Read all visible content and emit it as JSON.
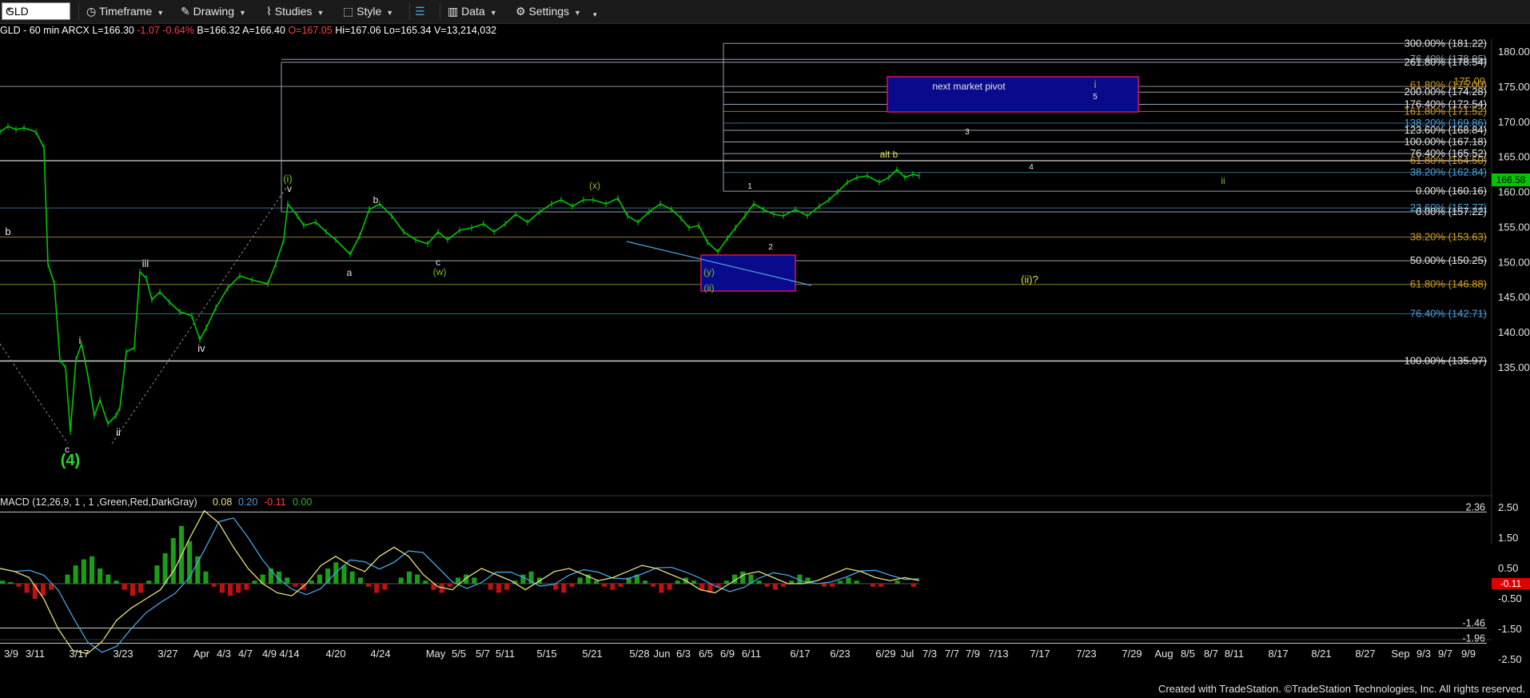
{
  "toolbar": {
    "symbol": "GLD",
    "timeframe": "Timeframe",
    "drawing": "Drawing",
    "studies": "Studies",
    "style": "Style",
    "data": "Data",
    "settings": "Settings"
  },
  "quote": {
    "name": "GLD - 60 min",
    "exchange": "ARCX",
    "last": "L=166.30",
    "change": "-1.07",
    "pct": "-0.64%",
    "bid": "B=166.32",
    "ask_label": "A=166.40",
    "open": "O=167.05",
    "high": "Hi=167.06",
    "low": "Lo=165.34",
    "volume": "V=13,214,032"
  },
  "colors": {
    "price": "#00c800",
    "fib_line": "#8f96a8",
    "box_fill": "#0a0a8c",
    "box_border": "#d4145a",
    "wave_green": "#7fbf2a",
    "wave_yellow": "#e5e04d",
    "macd_line": "#e8e07a",
    "signal_line": "#4aa3df",
    "hist_up": "#1b9d1b",
    "hist_dn": "#c01010"
  },
  "price_axis": [
    "180.00",
    "175.00",
    "170.00",
    "165.00",
    "160.00",
    "155.00",
    "150.00",
    "145.00",
    "140.00",
    "135.00"
  ],
  "price_tag": "166.58",
  "fib_labels": [
    {
      "text": "300.00% (181.22)",
      "color": "#e6e6e6"
    },
    {
      "text": "76.40% (178.95)",
      "color": "#8fa3b3"
    },
    {
      "text": "261.80% (178.54)",
      "color": "#e6e6e6"
    },
    {
      "text": "61.80% (175.00)",
      "color": "#d4a017"
    },
    {
      "text": "175.09",
      "color": "#d4a017"
    },
    {
      "text": "200.00% (174.28)",
      "color": "#e6e6e6"
    },
    {
      "text": "176.40% (172.54)",
      "color": "#e6e6e6"
    },
    {
      "text": "161.80% (171.52)",
      "color": "#d4a017"
    },
    {
      "text": "138.20% (169.86)",
      "color": "#4aa3df"
    },
    {
      "text": "123.60% (168.84)",
      "color": "#e6e6e6"
    },
    {
      "text": "100.00% (167.18)",
      "color": "#e6e6e6"
    },
    {
      "text": "76.40% (165.52)",
      "color": "#e6e6e6"
    },
    {
      "text": "61.80% (164.50)",
      "color": "#d4a017"
    },
    {
      "text": "38.20% (162.84)",
      "color": "#4aa3df"
    },
    {
      "text": "0.00% (160.16)",
      "color": "#e6e6e6"
    },
    {
      "text": "23.60% (157.77)",
      "color": "#4aa3df"
    },
    {
      "text": "0.00% (157.22)",
      "color": "#e6e6e6"
    },
    {
      "text": "38.20% (153.63)",
      "color": "#d4a017"
    },
    {
      "text": "50.00% (150.25)",
      "color": "#e6e6e6"
    },
    {
      "text": "61.80% (146.88)",
      "color": "#d4a017"
    },
    {
      "text": "76.40% (142.71)",
      "color": "#4aa3df"
    },
    {
      "text": "100.00% (135.97)",
      "color": "#e6e6e6"
    }
  ],
  "wave_labels": [
    {
      "text": "b",
      "color": "#e6e6e6"
    },
    {
      "text": "i",
      "color": "#e6e6e6"
    },
    {
      "text": "ii",
      "color": "#e6e6e6"
    },
    {
      "text": "iii",
      "color": "#e6e6e6"
    },
    {
      "text": "iv",
      "color": "#e6e6e6"
    },
    {
      "text": "c",
      "color": "#e6e6e6"
    },
    {
      "text": "(4)",
      "color": "#22dd22"
    },
    {
      "text": "(i)",
      "color": "#7fbf2a"
    },
    {
      "text": "v",
      "color": "#e6e6e6"
    },
    {
      "text": "a",
      "color": "#e6e6e6"
    },
    {
      "text": "b",
      "color": "#e6e6e6"
    },
    {
      "text": "c",
      "color": "#e6e6e6"
    },
    {
      "text": "(w)",
      "color": "#7fbf2a"
    },
    {
      "text": "(x)",
      "color": "#7fbf2a"
    },
    {
      "text": "(y)",
      "color": "#7fbf2a"
    },
    {
      "text": "(ii)",
      "color": "#7fbf2a"
    },
    {
      "text": "1",
      "color": "#e6e6e6"
    },
    {
      "text": "2",
      "color": "#e6e6e6"
    },
    {
      "text": "3",
      "color": "#e6e6e6"
    },
    {
      "text": "4",
      "color": "#e6e6e6"
    },
    {
      "text": "5",
      "color": "#e6e6e6"
    },
    {
      "text": "i",
      "color": "#7fbf2a"
    },
    {
      "text": "ii",
      "color": "#7fbf2a"
    },
    {
      "text": "alt b",
      "color": "#e5e04d"
    },
    {
      "text": "(ii)?",
      "color": "#e5e04d"
    }
  ],
  "pivot_label": "next market pivot",
  "macd": {
    "title": "MACD (12,26,9, 1 , 1 ,Green,Red,DarkGray)",
    "v1": "0.08",
    "v2": "0.20",
    "v3": "-0.11",
    "v4": "0.00",
    "axis": [
      "2.50",
      "1.50",
      "0.50",
      "-0.50",
      "-1.50",
      "-2.50"
    ],
    "level_hi": "2.36",
    "level_lo1": "-1.46",
    "level_lo2": "-1.96",
    "tag": "-0.11"
  },
  "x_axis": [
    "3/9",
    "3/11",
    "3/17",
    "3/23",
    "3/27",
    "Apr",
    "4/3",
    "4/7",
    "4/9",
    "4/14",
    "4/20",
    "4/24",
    "May",
    "5/5",
    "5/7",
    "5/11",
    "5/15",
    "5/21",
    "5/28",
    "Jun",
    "6/3",
    "6/5",
    "6/9",
    "6/11",
    "6/17",
    "6/23",
    "6/29",
    "Jul",
    "7/3",
    "7/7",
    "7/9",
    "7/13",
    "7/17",
    "7/23",
    "7/29",
    "Aug",
    "8/5",
    "8/7",
    "8/11",
    "8/17",
    "8/21",
    "8/27",
    "Sep",
    "9/3",
    "9/7",
    "9/9"
  ],
  "footer": "Created with TradeStation. ©TradeStation Technologies, Inc. All rights reserved."
}
